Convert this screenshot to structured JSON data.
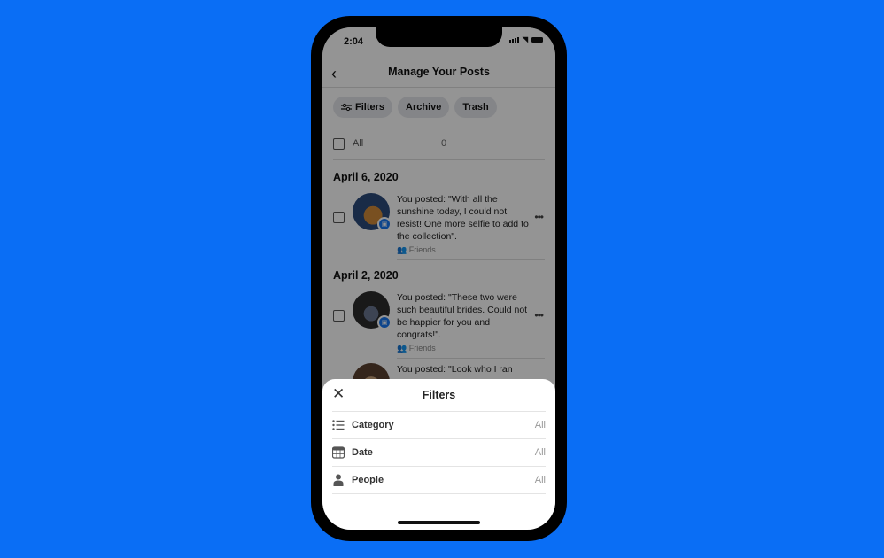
{
  "status_bar": {
    "time": "2:04"
  },
  "header": {
    "back_label": "‹",
    "title": "Manage Your Posts"
  },
  "chips": [
    {
      "label": "Filters",
      "icon": "sliders-icon"
    },
    {
      "label": "Archive"
    },
    {
      "label": "Trash"
    }
  ],
  "select_all": {
    "label": "All",
    "count": "0"
  },
  "groups": [
    {
      "date": "April 6, 2020",
      "posts": [
        {
          "text": "You posted: \"With all the sunshine today, I could not resist! One more selfie to add to the collection\".",
          "audience": "Friends"
        }
      ]
    },
    {
      "date": "April 2, 2020",
      "posts": [
        {
          "text": "You posted: \"These two were such beautiful brides. Could not be happier for you and congrats!\".",
          "audience": "Friends"
        },
        {
          "text": "You posted: \"Look who I ran",
          "audience": ""
        }
      ]
    }
  ],
  "more_label": "•••",
  "filters_sheet": {
    "close_label": "✕",
    "title": "Filters",
    "rows": [
      {
        "label": "Category",
        "value": "All",
        "icon": "list-icon"
      },
      {
        "label": "Date",
        "value": "All",
        "icon": "calendar-icon"
      },
      {
        "label": "People",
        "value": "All",
        "icon": "person-icon"
      }
    ]
  },
  "colors": {
    "background": "#0A6EF5",
    "accent": "#1877F2"
  }
}
